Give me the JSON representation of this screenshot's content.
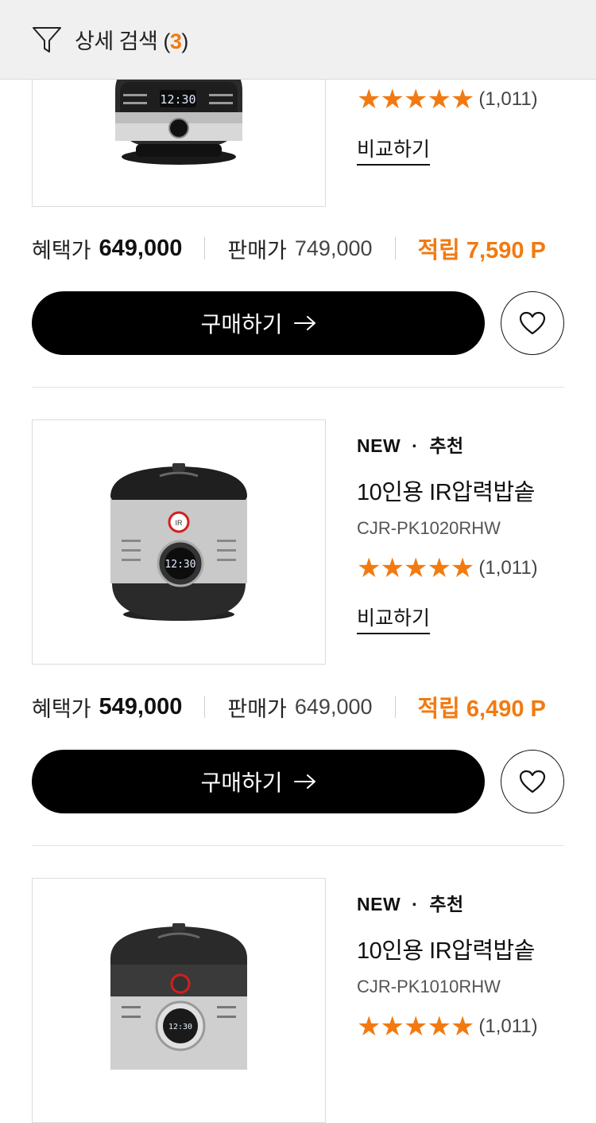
{
  "filter": {
    "label": "상세 검색",
    "count_open": "(",
    "count": "3",
    "count_close": ")"
  },
  "products": [
    {
      "rating_stars": "★★★★★",
      "review_count": "(1,011)",
      "compare_label": "비교하기",
      "benefit_label": "혜택가",
      "benefit_price": "649,000",
      "sale_label": "판매가",
      "sale_price": "749,000",
      "points": "적립 7,590 P",
      "buy_label": "구매하기"
    },
    {
      "tag_new": "NEW",
      "tag_dot": "·",
      "tag_recommend": "추천",
      "name": "10인용 IR압력밥솥",
      "model": "CJR-PK1020RHW",
      "rating_stars": "★★★★★",
      "review_count": "(1,011)",
      "compare_label": "비교하기",
      "benefit_label": "혜택가",
      "benefit_price": "549,000",
      "sale_label": "판매가",
      "sale_price": "649,000",
      "points": "적립 6,490 P",
      "buy_label": "구매하기"
    },
    {
      "tag_new": "NEW",
      "tag_dot": "·",
      "tag_recommend": "추천",
      "name": "10인용 IR압력밥솥",
      "model": "CJR-PK1010RHW",
      "rating_stars": "★★★★★",
      "review_count": "(1,011)"
    }
  ],
  "colors": {
    "accent": "#f27a10",
    "button": "#000000",
    "background": "#ffffff",
    "topbar": "#f0f0f0"
  },
  "icons": {
    "filter": "filter-funnel-icon",
    "arrow": "arrow-right-icon",
    "wish": "heart-outline-icon"
  }
}
